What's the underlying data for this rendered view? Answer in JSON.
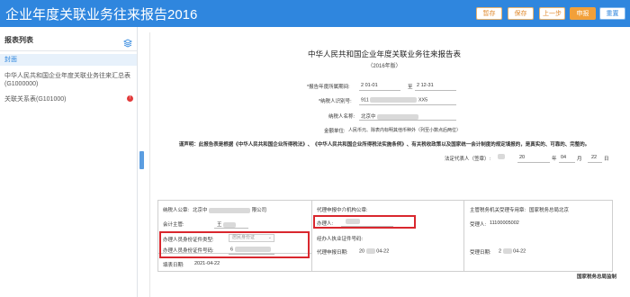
{
  "app": {
    "title": "企业年度关联业务往来报告2016"
  },
  "toolbar": {
    "buttons": [
      {
        "label": "暂存"
      },
      {
        "label": "保存"
      },
      {
        "label": "上一步"
      },
      {
        "label": "申报"
      },
      {
        "label": "重置"
      }
    ],
    "colors": {
      "header": "#2f86de",
      "accent": "#f2a03a"
    }
  },
  "sidebar": {
    "title": "报表列表",
    "items": [
      {
        "label": "封面",
        "active": true
      },
      {
        "label": "中华人民共和国企业年度关联业务往来汇总表(G1000000)"
      },
      {
        "label": "关联关系表(G101000)",
        "badge": "!"
      }
    ]
  },
  "doc": {
    "title": "中华人民共和国企业年度关联业务往来报告表",
    "subtitle": "（2016年版）",
    "period_label": "*报告年度所属期间:",
    "period_from": "2   01-01",
    "period_to_label": "至",
    "period_to": "2   12-31",
    "taxid_label": "*纳税人识别号:",
    "taxid_value": "911",
    "taxid_tail": "XX5",
    "name_label": "纳税人名称:",
    "name_value": "北京中",
    "currency_label": "金额单位:",
    "currency_value": "人民币元、除表内标明其他币种外（列至小数点后两位）",
    "statement": "谨声明：此报告表是根据《中华人民共和国企业所得税法》、《中华人民共和国企业所得税法实施条例》、有关税收政策以及国家统一会计制度的规定填报的，是真实的、可靠的、完整的。",
    "legal_rep_label": "法定代表人（签章）:",
    "sign_year": "20",
    "sign_year_unit": "年",
    "sign_month": "04",
    "sign_month_unit": "月",
    "sign_day": "22",
    "sign_day_unit": "日"
  },
  "table": {
    "col1": {
      "taxpayer_seal_label": "纳税人公章:",
      "taxpayer_seal_value": "北京中",
      "taxpayer_seal_tail": "限公司",
      "accountant_label": "会计主管:",
      "accountant_value": "王",
      "id_type_label": "办理人员身份证件类型:",
      "id_type_placeholder": "居民身份证",
      "id_no_label": "办理人员身份证件号码:",
      "id_no_value": "6",
      "fill_date_label": "填表日期:",
      "fill_date_value": "2021-04-22"
    },
    "col2": {
      "agent_seal_label": "代理申报中介机构公章:",
      "handler_label": "办理人:",
      "agent_cert_label": "经办人执业证件号码:",
      "agent_date_label": "代理申报日期:",
      "agent_date_value": "20",
      "agent_date_tail": "04-22"
    },
    "col3": {
      "authority_label": "主管税务机关受理专用章:",
      "authority_value": "国家税务总局北京",
      "receiver_label": "受理人:",
      "receiver_value": "11100005002",
      "receive_date_label": "受理日期:",
      "receive_date_value": "2",
      "receive_date_tail": "04-22"
    },
    "footer": "国家税务总局监制"
  }
}
